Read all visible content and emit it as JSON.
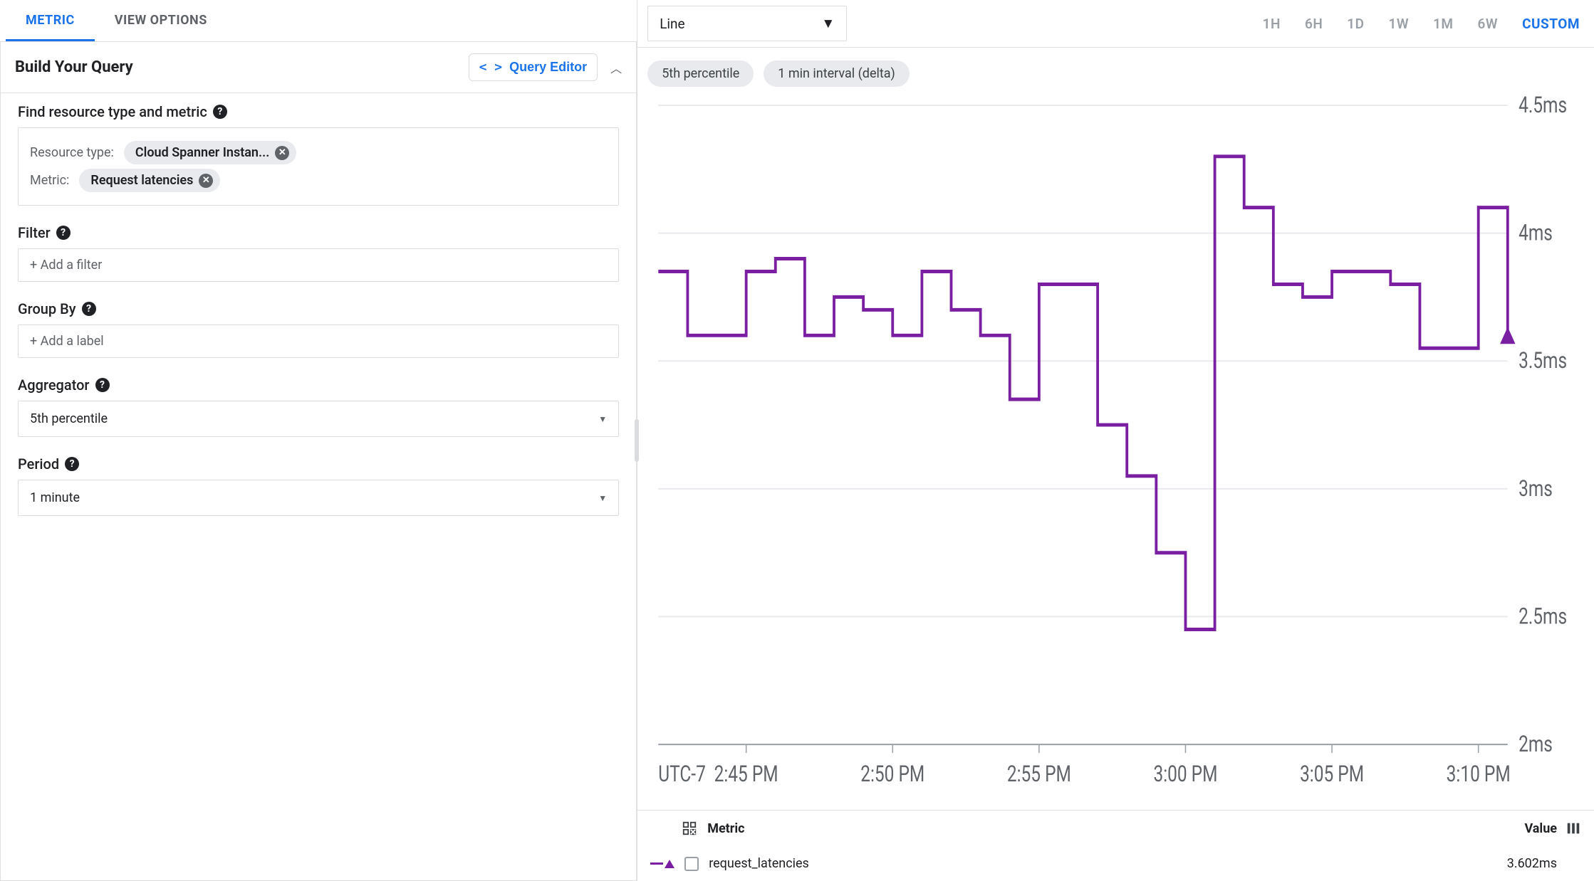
{
  "tabs": {
    "metric": "METRIC",
    "view_options": "VIEW OPTIONS"
  },
  "panel": {
    "title": "Build Your Query",
    "editor_button": "Query Editor"
  },
  "sections": {
    "find": {
      "label": "Find resource type and metric",
      "resource_type_label": "Resource type:",
      "resource_type_chip": "Cloud Spanner Instan...",
      "metric_label": "Metric:",
      "metric_chip": "Request latencies"
    },
    "filter": {
      "label": "Filter",
      "placeholder": "+ Add a filter"
    },
    "groupby": {
      "label": "Group By",
      "placeholder": "+ Add a label"
    },
    "aggregator": {
      "label": "Aggregator",
      "value": "5th percentile"
    },
    "period": {
      "label": "Period",
      "value": "1 minute"
    }
  },
  "chart_toolbar": {
    "chart_type": "Line",
    "ranges": [
      "1H",
      "6H",
      "1D",
      "1W",
      "1M",
      "6W",
      "CUSTOM"
    ],
    "active_range": "CUSTOM"
  },
  "chart_badges": {
    "percentile": "5th percentile",
    "interval": "1 min interval (delta)"
  },
  "chart_axes": {
    "y_ticks": [
      "4.5ms",
      "4ms",
      "3.5ms",
      "3ms",
      "2.5ms",
      "2ms"
    ],
    "x_tz": "UTC-7",
    "x_ticks": [
      "2:45 PM",
      "2:50 PM",
      "2:55 PM",
      "3:00 PM",
      "3:05 PM",
      "3:10 PM"
    ]
  },
  "legend": {
    "metric_header": "Metric",
    "value_header": "Value",
    "rows": [
      {
        "name": "request_latencies",
        "value": "3.602ms"
      }
    ]
  },
  "chart_data": {
    "type": "line",
    "title": "",
    "xlabel": "",
    "ylabel": "",
    "ylim": [
      2,
      4.5
    ],
    "x_tz": "UTC-7",
    "categories": [
      "2:42",
      "2:43",
      "2:44",
      "2:45",
      "2:46",
      "2:47",
      "2:48",
      "2:49",
      "2:50",
      "2:51",
      "2:52",
      "2:53",
      "2:54",
      "2:55",
      "2:56",
      "2:57",
      "2:58",
      "2:59",
      "3:00",
      "3:01",
      "3:02",
      "3:03",
      "3:04",
      "3:05",
      "3:06",
      "3:07",
      "3:08",
      "3:09",
      "3:10",
      "3:11"
    ],
    "series": [
      {
        "name": "request_latencies",
        "values": [
          3.85,
          3.6,
          3.6,
          3.85,
          3.9,
          3.6,
          3.75,
          3.7,
          3.6,
          3.85,
          3.7,
          3.6,
          3.35,
          3.8,
          3.8,
          3.25,
          3.05,
          2.75,
          2.45,
          4.3,
          4.1,
          3.8,
          3.75,
          3.85,
          3.85,
          3.8,
          3.55,
          3.55,
          4.1,
          3.6
        ]
      }
    ]
  }
}
